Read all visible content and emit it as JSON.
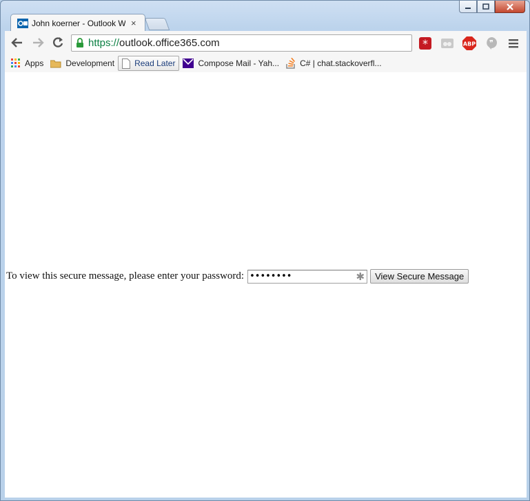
{
  "window": {
    "minimize_icon": "minimize-icon",
    "maximize_icon": "maximize-icon",
    "close_icon": "close-icon"
  },
  "tab": {
    "title": "John koerner - Outlook W",
    "close": "×",
    "favicon": "outlook-icon"
  },
  "omnibox": {
    "scheme": "https://",
    "host": "outlook.office365.com"
  },
  "extensions": [
    "lastpass-icon",
    "bookmark-manager-icon",
    "adblock-plus-icon",
    "hangouts-icon",
    "menu-icon"
  ],
  "bookmarks": {
    "items": [
      {
        "label": "Apps",
        "icon": "apps-grid-icon"
      },
      {
        "label": "Development",
        "icon": "folder-icon"
      },
      {
        "label": "Read Later",
        "icon": "page-icon"
      },
      {
        "label": "Compose Mail - Yah...",
        "icon": "yahoo-mail-icon"
      },
      {
        "label": "C# | chat.stackoverfl...",
        "icon": "stackoverflow-icon"
      }
    ]
  },
  "page": {
    "prompt": "To view this secure message, please enter your password:",
    "password_value": "••••••••",
    "button_label": "View Secure Message"
  },
  "colors": {
    "url_scheme": "#0b8043",
    "frame": "#b9d1ea"
  }
}
